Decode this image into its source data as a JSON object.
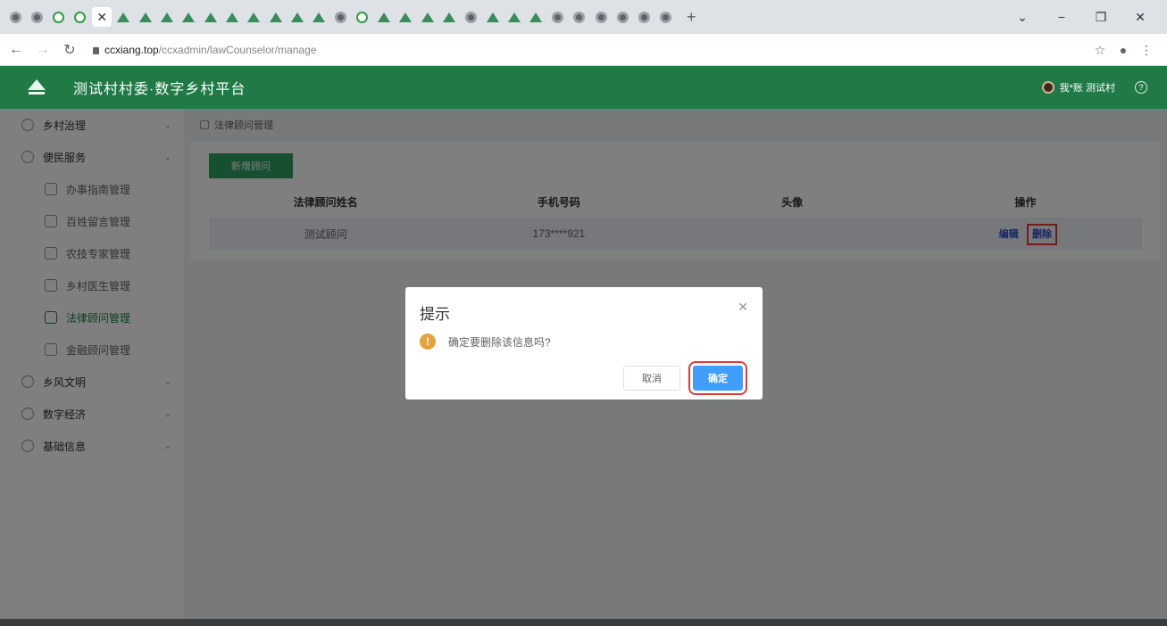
{
  "browser": {
    "tab_favicons": [
      "globe",
      "globe",
      "green-o",
      "green-o",
      "close",
      "tri",
      "tri",
      "tri",
      "tri",
      "tri",
      "tri",
      "tri",
      "tri",
      "tri",
      "tri",
      "globe",
      "green-o",
      "tri",
      "tri",
      "tri",
      "tri",
      "globe",
      "tri",
      "tri",
      "tri",
      "globe",
      "globe",
      "globe",
      "globe",
      "globe",
      "globe"
    ],
    "url_host": "ccxiang.top",
    "url_path": "/ccxadmin/lawCounselor/manage"
  },
  "header": {
    "title": "测试村村委·数字乡村平台",
    "user": "我*账 测试村"
  },
  "sidebar": {
    "items": [
      {
        "label": "乡村治理",
        "level": 1,
        "icon": "governance-icon"
      },
      {
        "label": "便民服务",
        "level": 1,
        "icon": "service-icon"
      },
      {
        "label": "办事指南管理",
        "level": 2,
        "icon": "guide-icon"
      },
      {
        "label": "百姓留言管理",
        "level": 2,
        "icon": "message-icon"
      },
      {
        "label": "农技专家管理",
        "level": 2,
        "icon": "expert-icon"
      },
      {
        "label": "乡村医生管理",
        "level": 2,
        "icon": "doctor-icon"
      },
      {
        "label": "法律顾问管理",
        "level": 2,
        "icon": "law-icon",
        "active": true
      },
      {
        "label": "金融顾问管理",
        "level": 2,
        "icon": "finance-icon"
      },
      {
        "label": "乡风文明",
        "level": 1,
        "icon": "culture-icon"
      },
      {
        "label": "数字经济",
        "level": 1,
        "icon": "economy-icon"
      },
      {
        "label": "基础信息",
        "level": 1,
        "icon": "info-icon"
      }
    ]
  },
  "main": {
    "breadcrumb": "法律顾问管理",
    "add_button": "新增顾问",
    "table": {
      "headers": [
        "法律顾问姓名",
        "手机号码",
        "头像",
        "操作"
      ],
      "rows": [
        {
          "name": "测试顾问",
          "phone": "173****921",
          "avatar": "",
          "edit": "编辑",
          "delete": "删除"
        }
      ]
    }
  },
  "dialog": {
    "title": "提示",
    "message": "确定要删除该信息吗?",
    "cancel": "取消",
    "confirm": "确定"
  },
  "colors": {
    "brand_green": "#1f7a45",
    "primary_blue": "#409eff",
    "warning": "#e6a23c",
    "highlight_red": "#e23a3a"
  }
}
